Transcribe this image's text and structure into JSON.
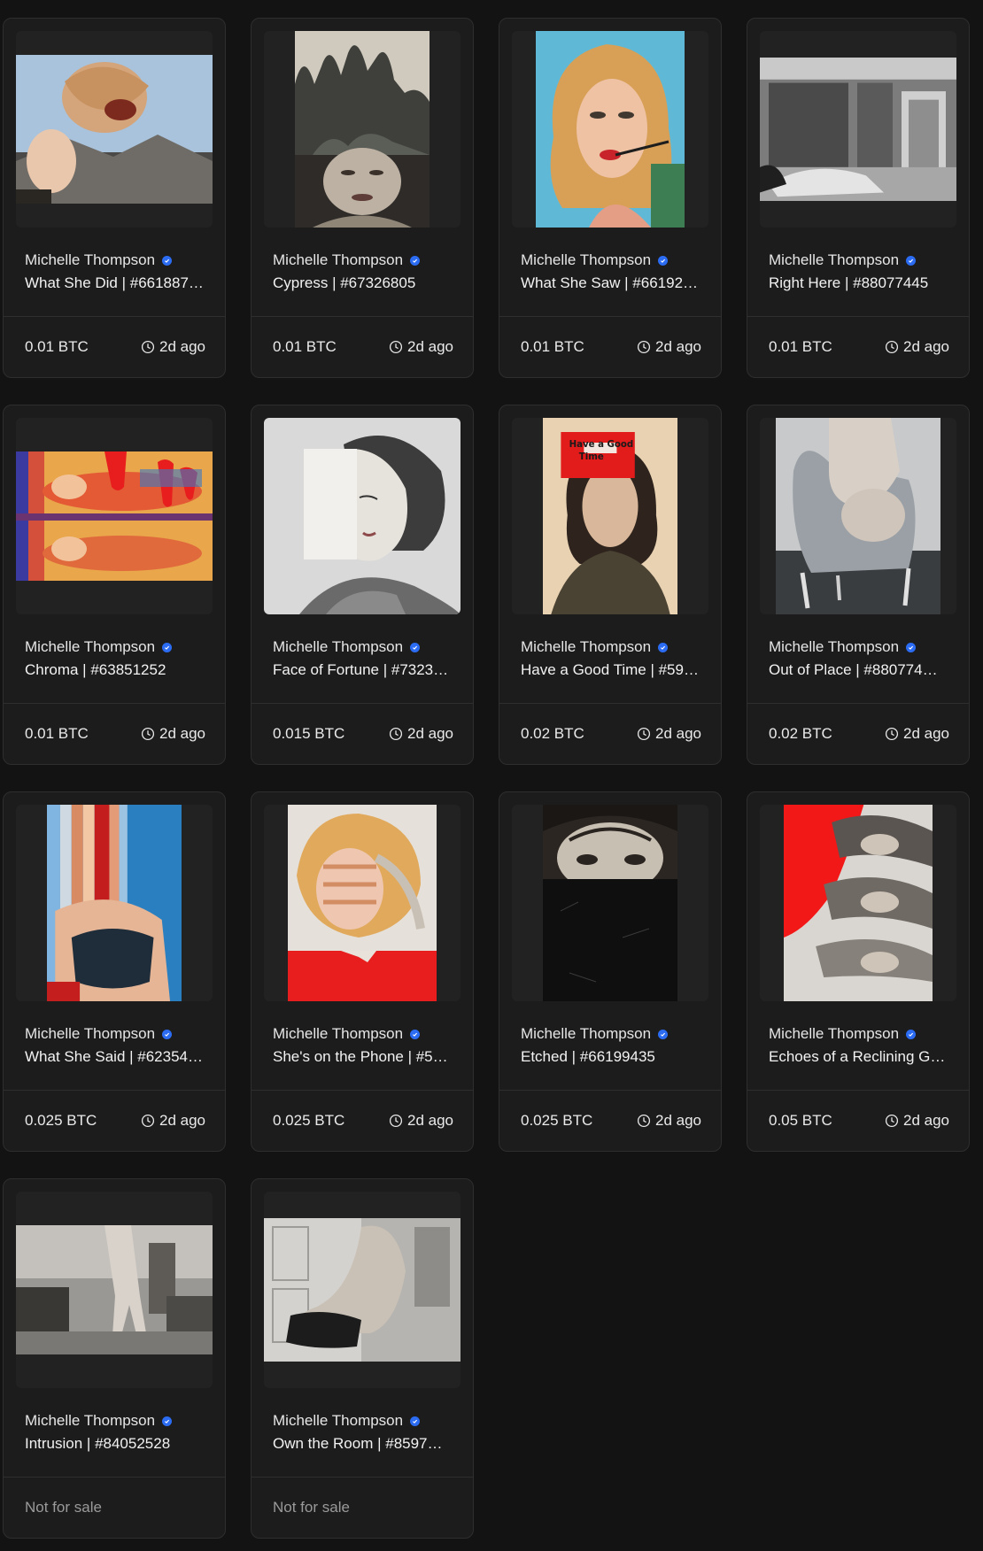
{
  "creator_name": "Michelle Thompson",
  "colors": {
    "background": "#131313",
    "card": "#1c1c1c",
    "verified": "#2b6cf3",
    "accent_red": "#e81e1e"
  },
  "cards": [
    {
      "title": "What She Did | #661887…",
      "price": "0.01 BTC",
      "time": "2d ago"
    },
    {
      "title": "Cypress | #67326805",
      "price": "0.01 BTC",
      "time": "2d ago"
    },
    {
      "title": "What She Saw | #66192…",
      "price": "0.01 BTC",
      "time": "2d ago"
    },
    {
      "title": "Right Here | #88077445",
      "price": "0.01 BTC",
      "time": "2d ago"
    },
    {
      "title": "Chroma | #63851252",
      "price": "0.01 BTC",
      "time": "2d ago"
    },
    {
      "title": "Face of Fortune | #7323…",
      "price": "0.015 BTC",
      "time": "2d ago"
    },
    {
      "title": "Have a Good Time | #59…",
      "price": "0.02 BTC",
      "time": "2d ago",
      "art_text": [
        "Have a Good",
        "Time"
      ]
    },
    {
      "title": "Out of Place | #880774…",
      "price": "0.02 BTC",
      "time": "2d ago"
    },
    {
      "title": "What She Said | #62354…",
      "price": "0.025 BTC",
      "time": "2d ago"
    },
    {
      "title": "She's on the Phone | #5…",
      "price": "0.025 BTC",
      "time": "2d ago"
    },
    {
      "title": "Etched | #66199435",
      "price": "0.025 BTC",
      "time": "2d ago"
    },
    {
      "title": "Echoes of a Reclining Gi…",
      "price": "0.05 BTC",
      "time": "2d ago"
    },
    {
      "title": "Intrusion | #84052528",
      "price": "Not for sale",
      "time": ""
    },
    {
      "title": "Own the Room | #8597…",
      "price": "Not for sale",
      "time": ""
    }
  ]
}
